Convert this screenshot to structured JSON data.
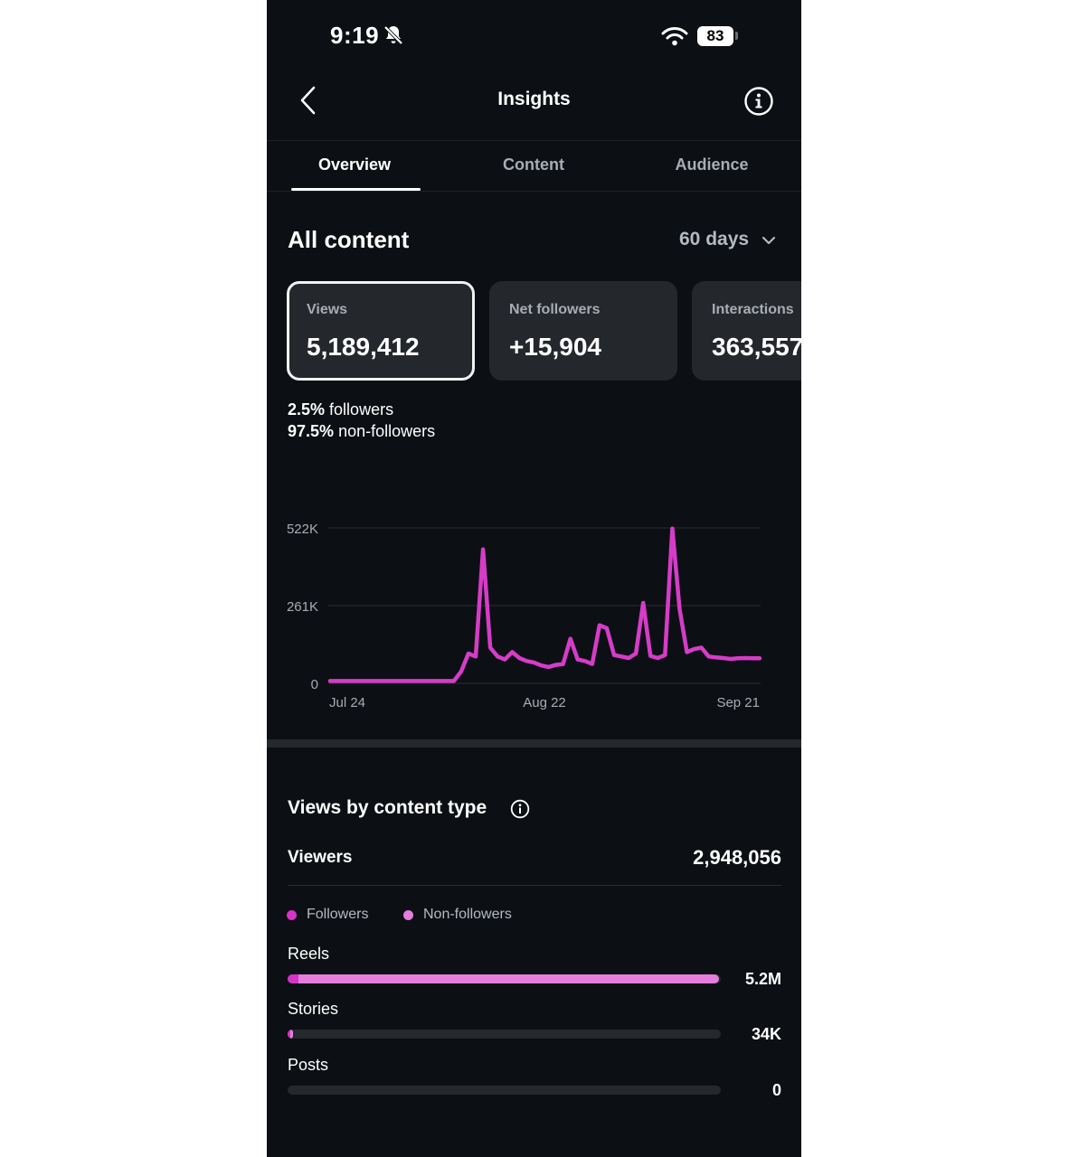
{
  "status": {
    "time": "9:19",
    "battery": "83"
  },
  "header": {
    "title": "Insights"
  },
  "tabs": [
    {
      "label": "Overview",
      "active": true
    },
    {
      "label": "Content",
      "active": false
    },
    {
      "label": "Audience",
      "active": false
    }
  ],
  "summary": {
    "title": "All content",
    "period": "60 days",
    "cards": [
      {
        "label": "Views",
        "value": "5,189,412",
        "selected": true
      },
      {
        "label": "Net followers",
        "value": "+15,904",
        "selected": false
      },
      {
        "label": "Interactions",
        "value": "363,557",
        "selected": false
      }
    ],
    "split": [
      {
        "percent": "2.5%",
        "label": "followers"
      },
      {
        "percent": "97.5%",
        "label": "non-followers"
      }
    ]
  },
  "chart_data": {
    "type": "line",
    "y_ticks": [
      "522K",
      "261K",
      "0"
    ],
    "x_ticks": [
      "Jul 24",
      "Aug 22",
      "Sep 21"
    ],
    "ylim": [
      0,
      522000
    ],
    "grid": true,
    "color": "#d63cc8",
    "x": [
      0,
      1,
      2,
      3,
      4,
      5,
      6,
      7,
      8,
      9,
      10,
      11,
      12,
      13,
      14,
      15,
      16,
      17,
      18,
      19,
      20,
      21,
      22,
      23,
      24,
      25,
      26,
      27,
      28,
      29,
      30,
      31,
      32,
      33,
      34,
      35,
      36,
      37,
      38,
      39,
      40,
      41,
      42,
      43,
      44,
      45,
      46,
      47,
      48,
      49,
      50,
      51,
      52,
      53,
      54,
      55,
      56,
      57,
      58,
      59
    ],
    "values": [
      8000,
      8000,
      8000,
      8000,
      8000,
      8000,
      8000,
      8000,
      8000,
      8000,
      8000,
      8000,
      8000,
      8000,
      8000,
      8000,
      8000,
      8000,
      40000,
      100000,
      90000,
      450000,
      120000,
      90000,
      80000,
      105000,
      85000,
      75000,
      70000,
      60000,
      55000,
      62000,
      65000,
      150000,
      80000,
      75000,
      65000,
      195000,
      185000,
      95000,
      90000,
      85000,
      100000,
      270000,
      92000,
      85000,
      95000,
      520000,
      250000,
      105000,
      115000,
      120000,
      90000,
      87000,
      85000,
      82000,
      84000,
      85000,
      84000,
      84000
    ],
    "values_note": ""
  },
  "content_type": {
    "title": "Views by content type",
    "viewers_label": "Viewers",
    "viewers_value": "2,948,056",
    "legend": [
      {
        "label": "Followers",
        "color": "#d633c8"
      },
      {
        "label": "Non-followers",
        "color": "#e57ddd"
      }
    ],
    "rows": [
      {
        "label": "Reels",
        "value": "5.2M",
        "total_fraction": 0.995,
        "followers_fraction": 0.025
      },
      {
        "label": "Stories",
        "value": "34K",
        "total_fraction": 0.012,
        "followers_fraction": 0.006
      },
      {
        "label": "Posts",
        "value": "0",
        "total_fraction": 0.0,
        "followers_fraction": 0.0
      }
    ]
  }
}
